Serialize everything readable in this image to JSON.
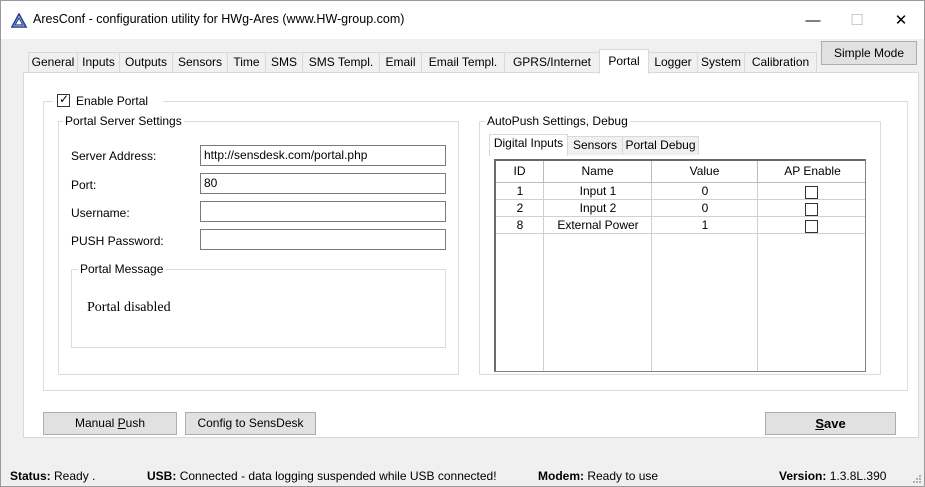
{
  "window": {
    "title": "AresConf - configuration utility for HWg-Ares (www.HW-group.com)",
    "controls": {
      "minimize": "—",
      "maximize": "☐",
      "close": "✕"
    }
  },
  "tabs": [
    {
      "label": "General",
      "active": false
    },
    {
      "label": "Inputs",
      "active": false
    },
    {
      "label": "Outputs",
      "active": false
    },
    {
      "label": "Sensors",
      "active": false
    },
    {
      "label": "Time",
      "active": false
    },
    {
      "label": "SMS",
      "active": false
    },
    {
      "label": "SMS Templ.",
      "active": false
    },
    {
      "label": "Email",
      "active": false
    },
    {
      "label": "Email Templ.",
      "active": false
    },
    {
      "label": "GPRS/Internet",
      "active": false
    },
    {
      "label": "Portal",
      "active": true
    },
    {
      "label": "Logger",
      "active": false
    },
    {
      "label": "System",
      "active": false
    },
    {
      "label": "Calibration",
      "active": false
    }
  ],
  "simple_mode_label": "Simple Mode",
  "portal": {
    "enable_label": "Enable Portal",
    "enable_checked": true,
    "server_group_title": "Portal Server Settings",
    "fields": {
      "server_address": {
        "label": "Server Address:",
        "value": "http://sensdesk.com/portal.php"
      },
      "port": {
        "label": "Port:",
        "value": "80"
      },
      "username": {
        "label": "Username:",
        "value": ""
      },
      "push_password": {
        "label": "PUSH Password:",
        "value": ""
      }
    },
    "message_group_title": "Portal Message",
    "message_text": "Portal disabled"
  },
  "autopush": {
    "group_title": "AutoPush Settings, Debug",
    "tabs": [
      {
        "label": "Digital Inputs",
        "active": true
      },
      {
        "label": "Sensors",
        "active": false
      },
      {
        "label": "Portal Debug",
        "active": false
      }
    ],
    "columns": [
      "ID",
      "Name",
      "Value",
      "AP Enable"
    ],
    "rows": [
      {
        "id": "1",
        "name": "Input 1",
        "value": "0",
        "ap_enable": false
      },
      {
        "id": "2",
        "name": "Input 2",
        "value": "0",
        "ap_enable": false
      },
      {
        "id": "8",
        "name": "External Power",
        "value": "1",
        "ap_enable": false
      }
    ]
  },
  "buttons": {
    "manual_push_prefix": "Manual ",
    "manual_push_accel": "P",
    "manual_push_suffix": "ush",
    "config_to_sensdesk": "Config to SensDesk",
    "save_accel": "S",
    "save_suffix": "ave"
  },
  "status": {
    "status_label": "Status:",
    "status_value": "Ready .",
    "usb_label": "USB:",
    "usb_value": "Connected - data logging suspended while USB connected!",
    "modem_label": "Modem:",
    "modem_value": "Ready to use",
    "version_label": "Version:",
    "version_value": "1.3.8L.390"
  },
  "colors": {
    "window_bg": "#f0f0f0",
    "panel_bg": "#ffffff",
    "button_bg": "#e1e1e1"
  }
}
